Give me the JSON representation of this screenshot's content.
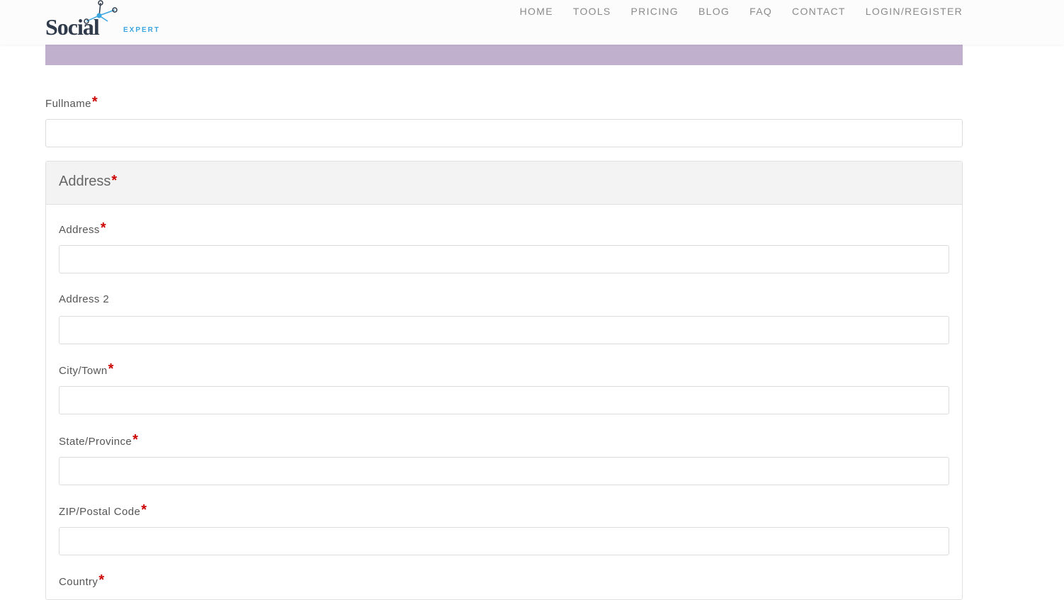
{
  "logo": {
    "main": "Social",
    "sub": "EXPERT"
  },
  "nav": [
    "HOME",
    "TOOLS",
    "PRICING",
    "BLOG",
    "FAQ",
    "CONTACT",
    "LOGIN/REGISTER"
  ],
  "form": {
    "fullname_label": "Fullname",
    "required_mark": "*",
    "address_panel_title": "Address",
    "address_label": "Address",
    "address2_label": "Address 2",
    "city_label": "City/Town",
    "state_label": "State/Province",
    "zip_label": "ZIP/Postal Code",
    "country_label": "Country"
  },
  "colors": {
    "banner": "#c0b0cd",
    "required": "#cc0000",
    "logo_accent": "#3aa6e0"
  }
}
